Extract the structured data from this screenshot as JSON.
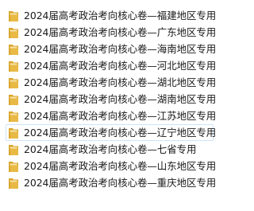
{
  "explorer": {
    "items": [
      {
        "label": "2024届高考政治考向核心卷—福建地区专用",
        "icon": "folder-icon",
        "selected": false
      },
      {
        "label": "2024届高考政治考向核心卷—广东地区专用",
        "icon": "folder-icon",
        "selected": false
      },
      {
        "label": "2024届高考政治考向核心卷—海南地区专用",
        "icon": "folder-icon",
        "selected": false
      },
      {
        "label": "2024届高考政治考向核心卷—河北地区专用",
        "icon": "folder-icon",
        "selected": false
      },
      {
        "label": "2024届高考政治考向核心卷—湖北地区专用",
        "icon": "folder-icon",
        "selected": false
      },
      {
        "label": "2024届高考政治考向核心卷—湖南地区专用",
        "icon": "folder-icon",
        "selected": false
      },
      {
        "label": "2024届高考政治考向核心卷—江苏地区专用",
        "icon": "folder-icon",
        "selected": false
      },
      {
        "label": "2024届高考政治考向核心卷—辽宁地区专用",
        "icon": "folder-icon",
        "selected": true
      },
      {
        "label": "2024届高考政治考向核心卷—七省专用",
        "icon": "folder-icon",
        "selected": false
      },
      {
        "label": "2024届高考政治考向核心卷—山东地区专用",
        "icon": "folder-icon",
        "selected": false
      },
      {
        "label": "2024届高考政治考向核心卷—重庆地区专用",
        "icon": "folder-icon",
        "selected": false
      }
    ]
  },
  "colors": {
    "folder_body": "#e8b945",
    "folder_tab": "#d9a52b",
    "folder_paper": "#f6e3a6",
    "selection_border": "#cfe3f7"
  }
}
